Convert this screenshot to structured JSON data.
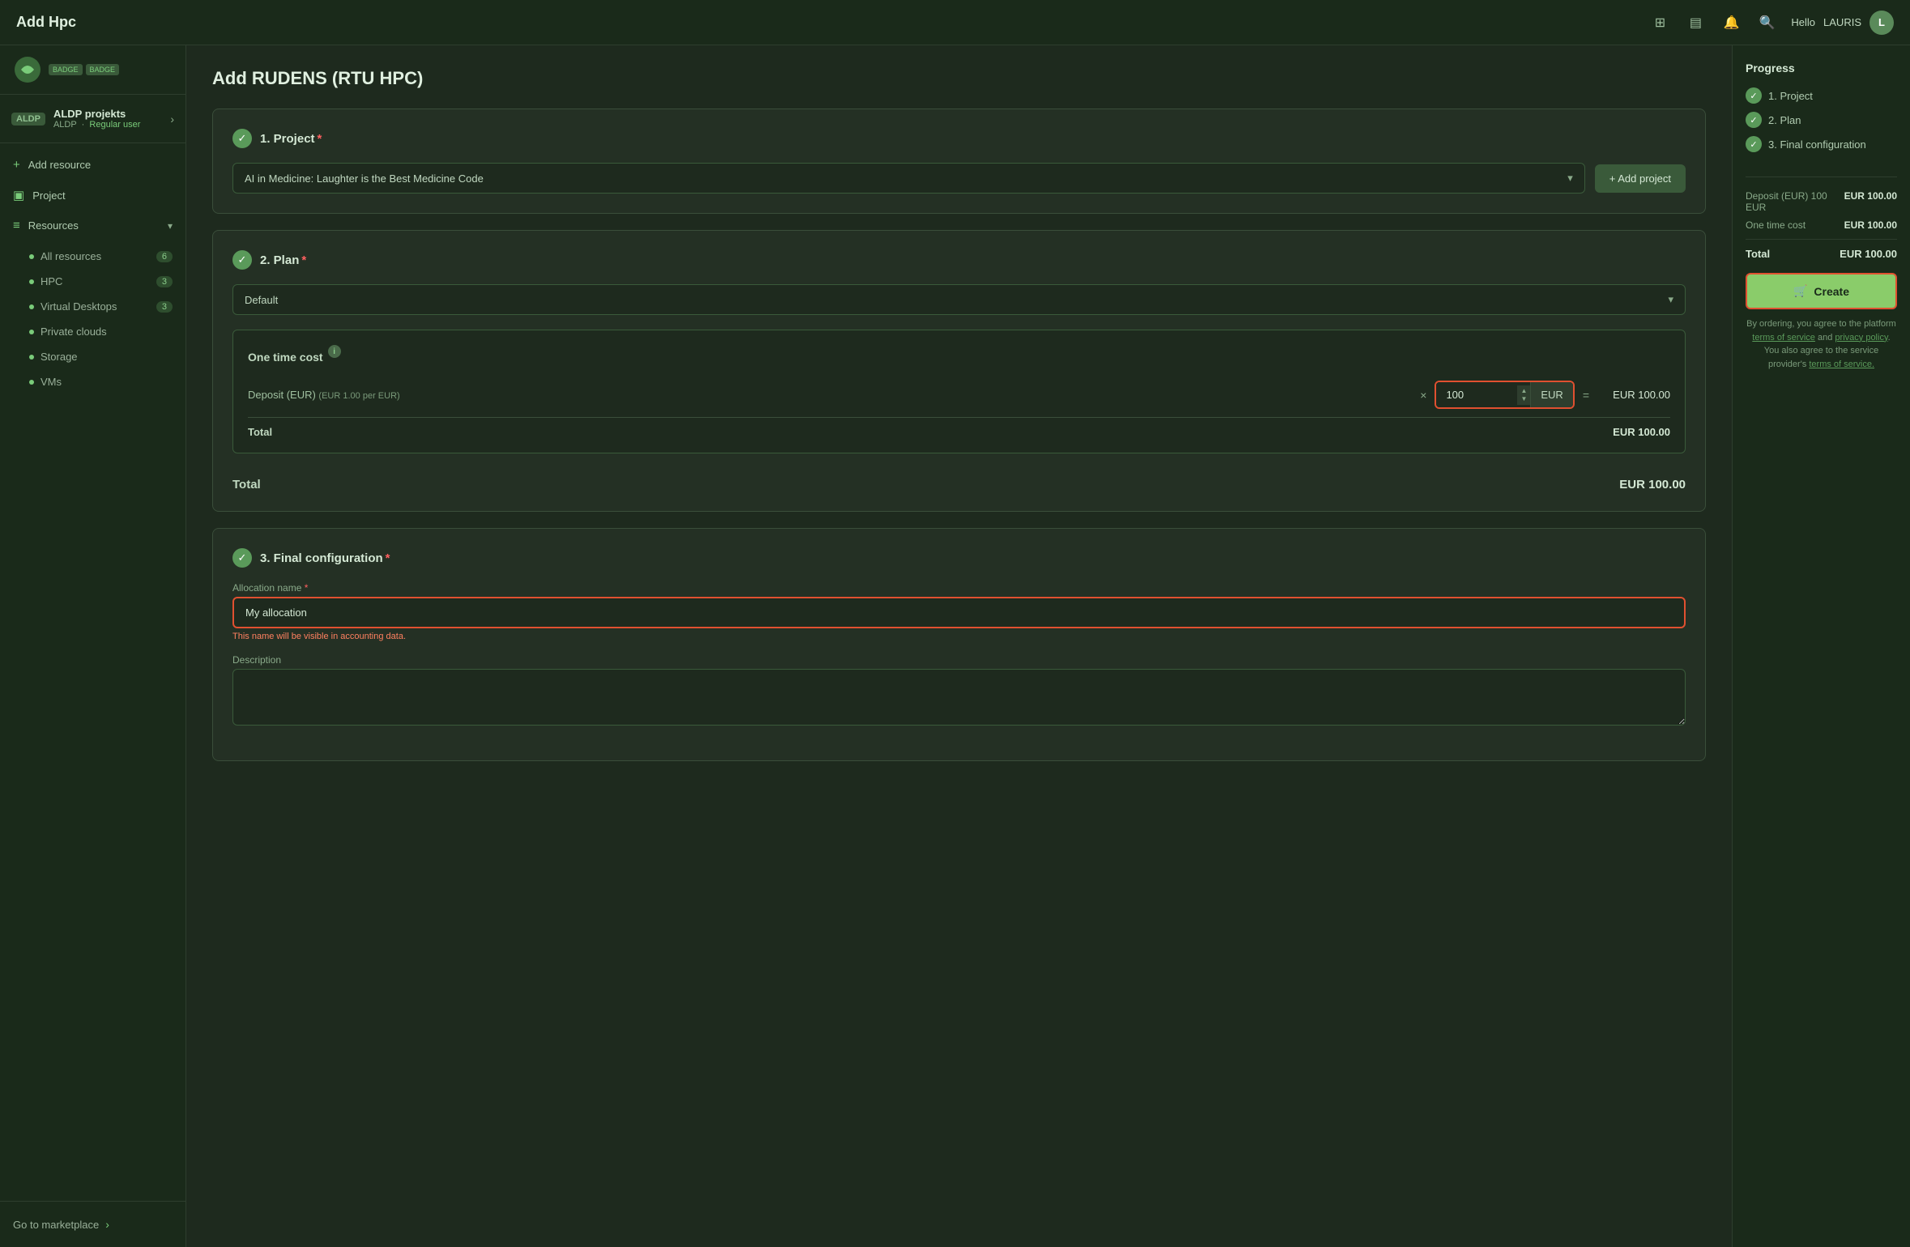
{
  "topbar": {
    "title": "Add Hpc",
    "user_greeting": "Hello",
    "user_name": "LAURIS",
    "user_initial": "L"
  },
  "sidebar": {
    "account": {
      "badge": "ALDP",
      "name": "ALDP projekts",
      "sub": "ALDP",
      "role": "Regular user"
    },
    "nav_items": [
      {
        "id": "add-resource",
        "label": "Add resource",
        "icon": "+"
      },
      {
        "id": "project",
        "label": "Project",
        "icon": "□"
      }
    ],
    "resources": {
      "label": "Resources",
      "sub_items": [
        {
          "label": "All resources",
          "count": "6"
        },
        {
          "label": "HPC",
          "count": "3"
        },
        {
          "label": "Virtual Desktops",
          "count": "3"
        },
        {
          "label": "Private clouds",
          "count": ""
        },
        {
          "label": "Storage",
          "count": ""
        },
        {
          "label": "VMs",
          "count": ""
        }
      ]
    },
    "footer": {
      "label": "Go to marketplace"
    }
  },
  "page": {
    "title": "Add RUDENS (RTU HPC)"
  },
  "section1": {
    "number": "1. Project",
    "project_value": "AI in Medicine: Laughter is the Best Medicine Code",
    "add_project_label": "+ Add project"
  },
  "section2": {
    "number": "2. Plan",
    "plan_value": "Default",
    "cost_section_title": "One time cost",
    "deposit_label": "Deposit (EUR)",
    "deposit_hint": "(EUR 1.00 per EUR)",
    "deposit_quantity": "100",
    "deposit_currency": "EUR",
    "deposit_result": "EUR 100.00",
    "total_label": "Total",
    "total_value": "EUR 100.00",
    "section_total_label": "Total",
    "section_total_value": "EUR 100.00"
  },
  "section3": {
    "number": "3. Final configuration",
    "allocation_label": "Allocation name",
    "allocation_required": "*",
    "allocation_value": "My allocation",
    "allocation_hint": "This name will be visible in accounting data.",
    "description_label": "Description"
  },
  "right_panel": {
    "progress_title": "Progress",
    "steps": [
      {
        "label": "1. Project"
      },
      {
        "label": "2. Plan"
      },
      {
        "label": "3. Final configuration"
      }
    ],
    "summary": {
      "deposit_label": "Deposit (EUR) 100 EUR",
      "deposit_value": "EUR 100.00",
      "one_time_label": "One time cost",
      "one_time_value": "EUR 100.00",
      "total_label": "Total",
      "total_value": "EUR 100.00"
    },
    "create_label": "Create",
    "agree_text_1": "By ordering, you agree to the platform",
    "agree_link1": "terms of service",
    "agree_text_2": "and",
    "agree_link2": "privacy policy",
    "agree_text_3": "You also agree to the service provider's",
    "agree_link3": "terms of service."
  }
}
